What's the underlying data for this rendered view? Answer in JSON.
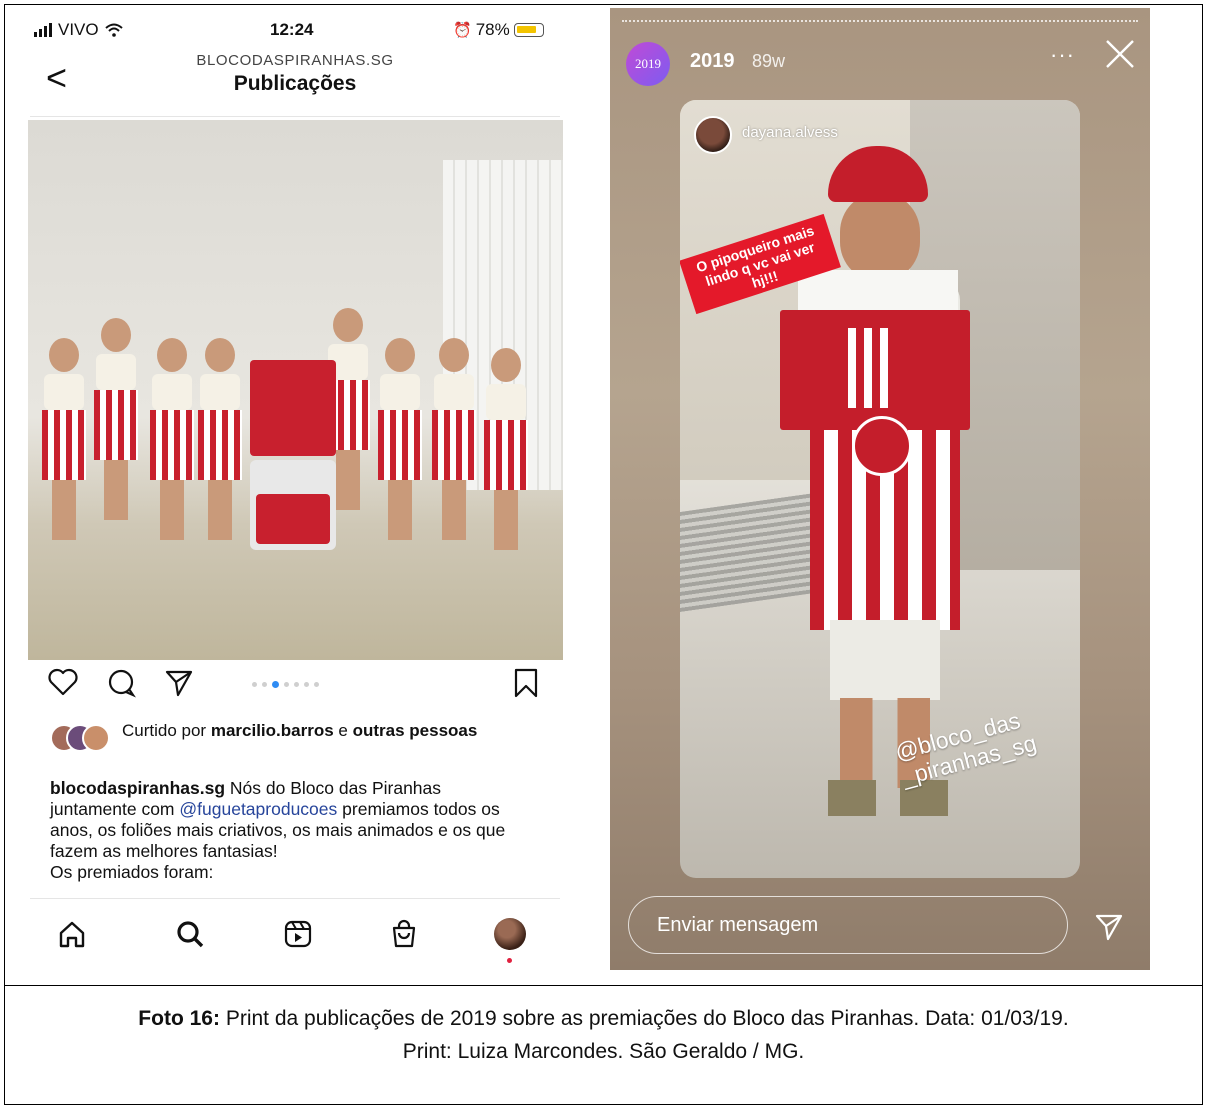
{
  "left_phone": {
    "status": {
      "carrier": "VIVO",
      "time": "12:24",
      "battery": "78%"
    },
    "header": {
      "username": "BLOCODASPIRANHAS.SG",
      "title": "Publicações",
      "back": "<"
    },
    "carousel": {
      "count": 7,
      "active_index": 2
    },
    "likes": {
      "prefix": "Curtido por",
      "user": "marcilio.barros",
      "joiner": "e",
      "others": "outras pessoas"
    },
    "caption": {
      "user": "blocodaspiranhas.sg",
      "text1": "Nós do Bloco das Piranhas juntamente com",
      "mention": "@fuguetaproducoes",
      "text2": "premiamos todos os anos, os foliões mais criativos, os mais animados e os que fazem as melhores fantasias!",
      "text3": "Os premiados foram:"
    },
    "tabs": [
      "home-icon",
      "search-icon",
      "reels-icon",
      "shop-icon",
      "profile-icon"
    ]
  },
  "story": {
    "avatar_label": "2019",
    "name": "2019",
    "time": "89w",
    "more": "···",
    "close": "✕",
    "card_user": "dayana.alvess",
    "sticker": "O pipoqueiro mais lindo q vc vai ver hj!!!",
    "tag_line1": "@bloco_das",
    "tag_line2": "_piranhas_sg",
    "message_placeholder": "Enviar mensagem"
  },
  "caption": {
    "label": "Foto 16:",
    "line1": "Print da publicações de 2019 sobre as premiações do Bloco das Piranhas. Data: 01/03/19.",
    "line2": "Print: Luiza Marcondes. São Geraldo / MG."
  },
  "colors": {
    "stripe_red": "#c8202e",
    "mention_blue": "#27459b",
    "active_dot": "#2f8cf3"
  }
}
